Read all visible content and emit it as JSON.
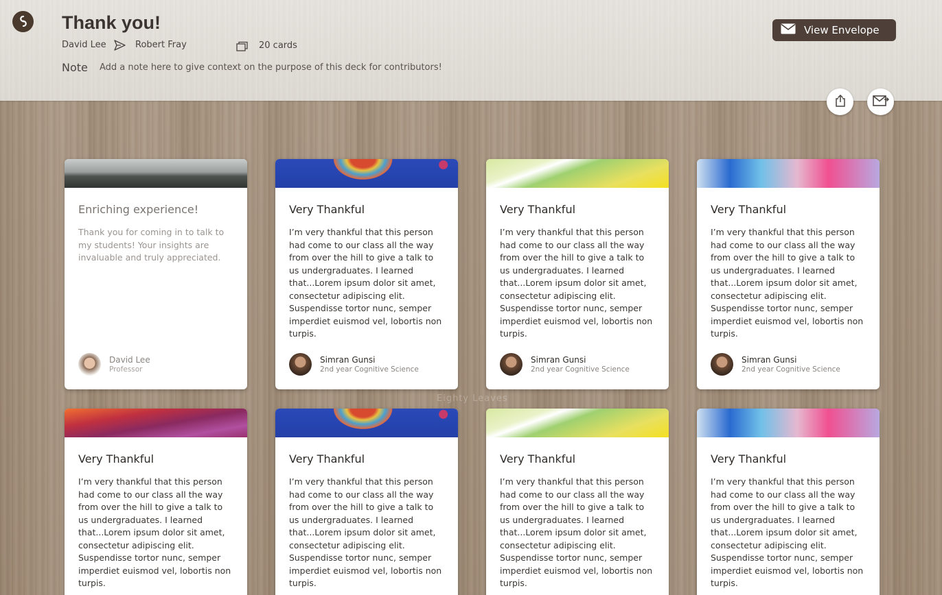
{
  "header": {
    "title": "Thank you!",
    "from": "David Lee",
    "to": "Robert Fray",
    "card_count": "20 cards",
    "note_label": "Note",
    "note_text": "Add a note here to give context on the purpose of this deck for contributors!",
    "envelope_button": "View Envelope"
  },
  "icons": {
    "logo": "logo-icon",
    "send": "send-icon",
    "cards": "cards-stack-icon",
    "envelope": "envelope-icon",
    "share": "share-icon",
    "mail": "mail-icon"
  },
  "colors": {
    "accent": "#4e4039",
    "header_bg": "#e3e0db",
    "wood": "#a48f7a"
  },
  "watermark": "Eighty Leaves",
  "cards": [
    {
      "title": "Enriching experience!",
      "body": "Thank you for coming in to talk to my students! Your insights are invaluable and truly appreciated.",
      "author": "David Lee",
      "role": "Professor"
    },
    {
      "title": "Very Thankful",
      "body": "I’m very thankful that this person had come to our class all the way from over the hill to give a talk to us undergraduates. I learned that...Lorem ipsum dolor sit amet, consectetur adipiscing elit. Suspendisse tortor nunc, semper imperdiet euismod vel, lobortis non turpis.",
      "author": "Simran Gunsi",
      "role": "2nd year Cognitive Science"
    },
    {
      "title": "Very Thankful",
      "body": "I’m very thankful that this person had come to our class all the way from over the hill to give a talk to us undergraduates. I learned that...Lorem ipsum dolor sit amet, consectetur adipiscing elit. Suspendisse tortor nunc, semper imperdiet euismod vel, lobortis non turpis.",
      "author": "Simran Gunsi",
      "role": "2nd year Cognitive Science"
    },
    {
      "title": "Very Thankful",
      "body": "I’m very thankful that this person had come to our class all the way from over the hill to give a talk to us undergraduates. I learned that...Lorem ipsum dolor sit amet, consectetur adipiscing elit. Suspendisse tortor nunc, semper imperdiet euismod vel, lobortis non turpis.",
      "author": "Simran Gunsi",
      "role": "2nd year Cognitive Science"
    },
    {
      "title": "Very Thankful",
      "body": "I’m very thankful that this person had come to our class all the way from over the hill to give a talk to us undergraduates. I learned that...Lorem ipsum dolor sit amet, consectetur adipiscing elit. Suspendisse tortor nunc, semper imperdiet euismod vel, lobortis non turpis."
    },
    {
      "title": "Very Thankful",
      "body": "I’m very thankful that this person had come to our class all the way from over the hill to give a talk to us undergraduates. I learned that...Lorem ipsum dolor sit amet, consectetur adipiscing elit. Suspendisse tortor nunc, semper imperdiet euismod vel, lobortis non turpis."
    },
    {
      "title": "Very Thankful",
      "body": "I’m very thankful that this person had come to our class all the way from over the hill to give a talk to us undergraduates. I learned that...Lorem ipsum dolor sit amet, consectetur adipiscing elit. Suspendisse tortor nunc, semper imperdiet euismod vel, lobortis non turpis."
    },
    {
      "title": "Very Thankful",
      "body": "I’m very thankful that this person had come to our class all the way from over the hill to give a talk to us undergraduates. I learned that...Lorem ipsum dolor sit amet, consectetur adipiscing elit. Suspendisse tortor nunc, semper imperdiet euismod vel, lobortis non turpis."
    }
  ]
}
